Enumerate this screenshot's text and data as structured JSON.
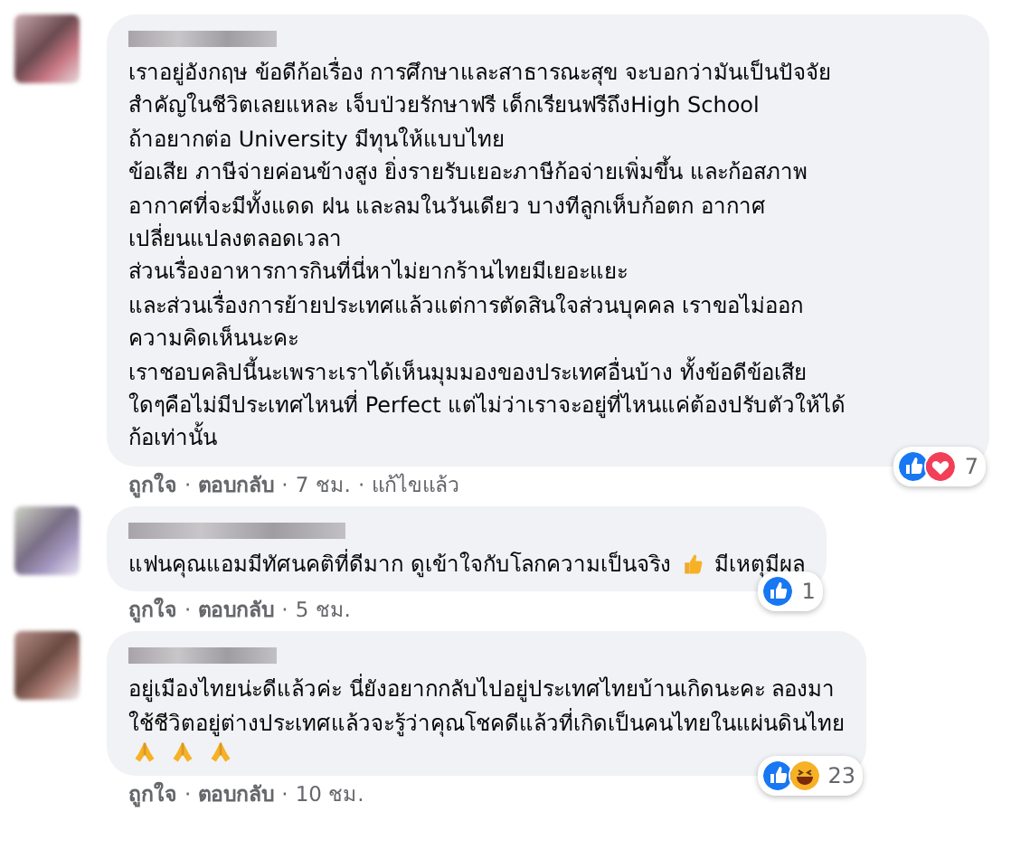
{
  "comments": [
    {
      "lines": [
        "เราอยู่อังกฤษ ข้อดีก้อเรื่อง การศึกษาและสาธารณะสุข จะบอกว่ามันเป็นปัจจัย",
        "สำคัญในชีวิตเลยแหละ เจ็บป่วยรักษาฟรี เด็กเรียนฟรีถึงHigh School",
        "ถ้าอยากต่อ University มีทุนให้แบบไทย",
        "ข้อเสีย ภาษีจ่ายค่อนข้างสูง ยิ่งรายรับเยอะภาษีก้อจ่ายเพิ่มขึ้น และก้อสภาพ",
        "อากาศที่จะมีทั้งแดด ฝน และลมในวันเดียว บางทีลูกเห็บก้อตก อากาศ",
        "เปลี่ยนแปลงตลอดเวลา",
        "ส่วนเรื่องอาหารการกินที่นี่หาไม่ยากร้านไทยมีเยอะแยะ",
        "และส่วนเรื่องการย้ายประเทศแล้วแต่การตัดสินใจส่วนบุคคล เราขอไม่ออก",
        "ความคิดเห็นนะคะ",
        "เราชอบคลิปนี้นะเพราะเราได้เห็นมุมมองของประเทศอื่นบ้าง ทั้งข้อดีข้อเสีย",
        "ใดๆคือไม่มีประเทศไหนที่ Perfect แต่ไม่ว่าเราจะอยู่ที่ไหนแค่ต้องปรับตัวให้ได้",
        "ก้อเท่านั้น"
      ],
      "reactions": [
        {
          "kind": "like"
        },
        {
          "kind": "love"
        }
      ],
      "reaction_count": "7",
      "actions": [
        "ถูกใจ",
        "ตอบกลับ",
        "7 ชม.",
        "แก้ไขแล้ว"
      ],
      "separators": [
        "·",
        "·",
        "·"
      ]
    },
    {
      "lines": [
        {
          "parts": [
            {
              "kind": "text",
              "text": "แฟนคุณแอมมีทัศนคติที่ดีมาก ดูเข้าใจกับโลกความเป็นจริง"
            },
            {
              "kind": "thumbs_up"
            },
            {
              "kind": "text",
              "text": "มีเหตุมีผล"
            }
          ]
        }
      ],
      "reactions": [
        {
          "kind": "like"
        }
      ],
      "reaction_count": "1",
      "actions": [
        "ถูกใจ",
        "ตอบกลับ",
        "5 ชม."
      ],
      "separators": [
        "·",
        "·"
      ]
    },
    {
      "lines": [
        "อยู่เมืองไทยน่ะดีแล้วค่ะ นี่ยังอยากกลับไปอยู่ประเทศไทยบ้านเกิดนะคะ ลองมา",
        "ใช้ชีวิตอยู่ต่างประเทศแล้วจะรู้ว่าคุณโชคดีแล้วที่เกิดเป็นคนไทยในแผ่นดินไทย",
        {
          "parts": [
            {
              "kind": "praying_hands"
            },
            {
              "kind": "praying_hands"
            },
            {
              "kind": "praying_hands"
            }
          ]
        }
      ],
      "reactions": [
        {
          "kind": "like"
        },
        {
          "kind": "haha"
        }
      ],
      "reaction_count": "23",
      "actions": [
        "ถูกใจ",
        "ตอบกลับ",
        "10 ชม."
      ],
      "separators": [
        "·",
        "·"
      ]
    }
  ]
}
